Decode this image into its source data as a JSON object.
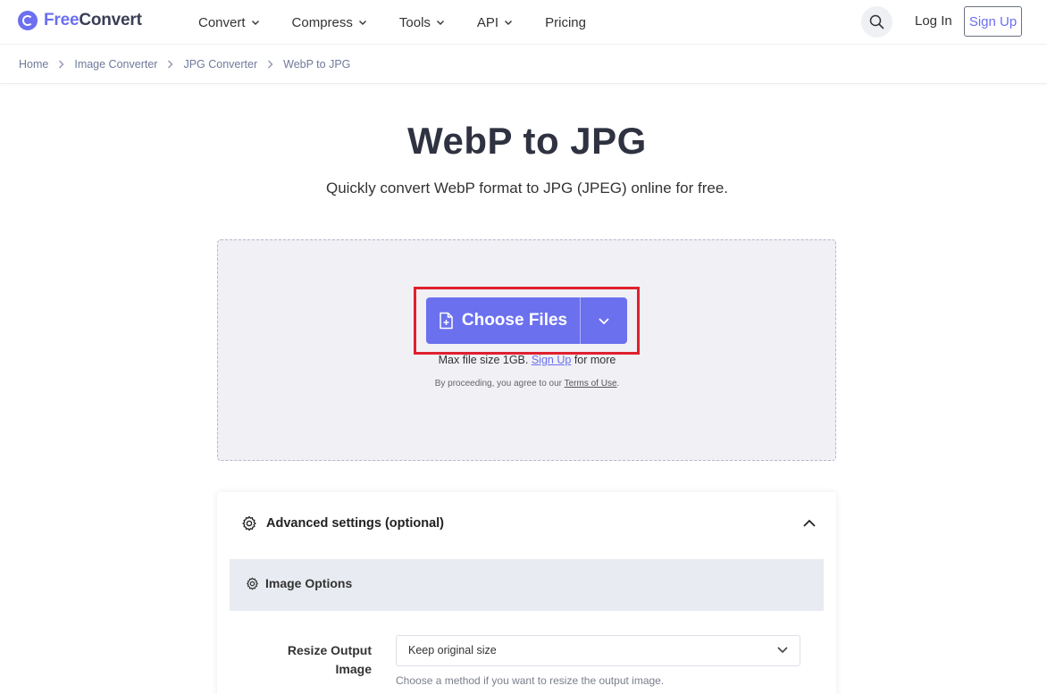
{
  "brand": {
    "name_prefix": "Free",
    "name_suffix": "Convert",
    "accent": "#6b6ff0"
  },
  "nav": {
    "items": [
      {
        "label": "Convert",
        "has_menu": true
      },
      {
        "label": "Compress",
        "has_menu": true
      },
      {
        "label": "Tools",
        "has_menu": true
      },
      {
        "label": "API",
        "has_menu": true
      },
      {
        "label": "Pricing",
        "has_menu": false
      }
    ],
    "search_icon": "search-icon",
    "login_label": "Log In",
    "signup_label": "Sign Up"
  },
  "breadcrumb": [
    "Home",
    "Image Converter",
    "JPG Converter",
    "WebP to JPG"
  ],
  "hero": {
    "title": "WebP to JPG",
    "subtitle": "Quickly convert WebP format to JPG (JPEG) online for free."
  },
  "upload": {
    "choose_label": "Choose Files",
    "max_prefix": "Max file size 1GB.",
    "max_link": "Sign Up",
    "max_suffix": "for more",
    "terms_prefix": "By proceeding, you agree to our",
    "terms_link": "Terms of Use",
    "terms_suffix": ".",
    "highlight_color": "#e0202e"
  },
  "advanced": {
    "title": "Advanced settings (optional)",
    "section_title": "Image Options",
    "resize": {
      "label": "Resize Output Image",
      "value": "Keep original size",
      "help": "Choose a method if you want to resize the output image."
    }
  }
}
